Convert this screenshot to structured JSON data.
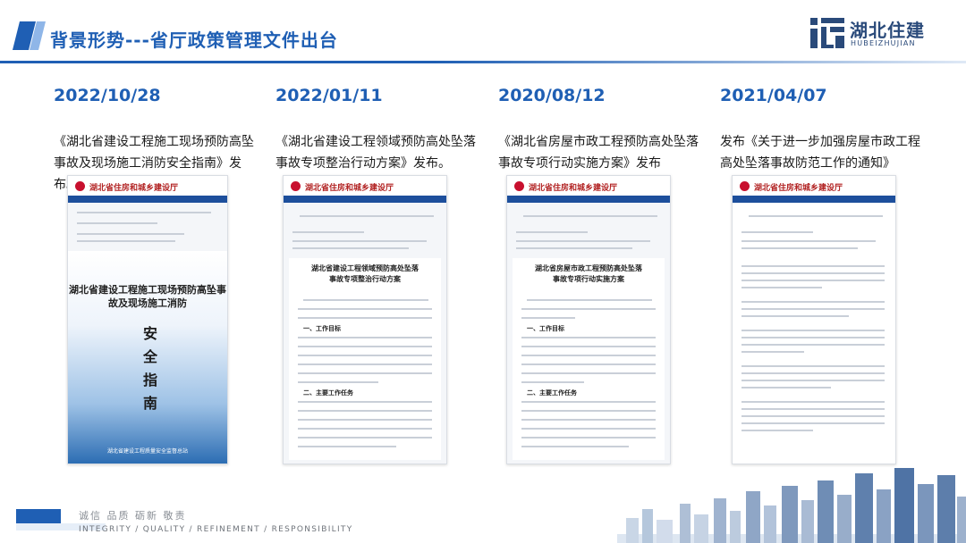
{
  "header": {
    "title": "背景形势---省厅政策管理文件出台",
    "logo_cn": "湖北住建",
    "logo_en": "HUBEIZHUJIAN"
  },
  "colors": {
    "accent": "#1f5fb4",
    "text": "#1a1a1a",
    "site_red": "#b22222"
  },
  "columns": [
    {
      "date": "2022/10/28",
      "description": "《湖北省建设工程施工现场预防高坠事故及现场施工消防安全指南》发布。",
      "doc": {
        "site": "湖北省住房和城乡建设厅",
        "cover_title": "湖北省建设工程施工现场预防高坠事故及现场施工消防",
        "cover_big": "安全指南",
        "cover_foot": "湖北省建设工程质量安全监督总站"
      }
    },
    {
      "date": "2022/01/11",
      "description": "《湖北省建设工程领域预防高处坠落事故专项整治行动方案》发布。",
      "doc": {
        "site": "湖北省住房和城乡建设厅",
        "paper_title": "湖北省建设工程领域预防高处坠落事故专项整治行动方案",
        "section1": "一、工作目标",
        "section2": "二、主要工作任务"
      }
    },
    {
      "date": "2020/08/12",
      "description": "《湖北省房屋市政工程预防高处坠落事故专项行动实施方案》发布",
      "doc": {
        "site": "湖北省住房和城乡建设厅",
        "paper_title": "湖北省房屋市政工程预防高处坠落事故专项行动实施方案",
        "section1": "一、工作目标",
        "section2": "二、主要工作任务"
      }
    },
    {
      "date": "2021/04/07",
      "description": "发布《关于进一步加强房屋市政工程高处坠落事故防范工作的通知》",
      "doc": {
        "site": "湖北省住房和城乡建设厅"
      }
    }
  ],
  "footer": {
    "slogan_cn": "诚信 品质 砺新 敬责",
    "slogan_en": "INTEGRITY / QUALITY / REFINEMENT / RESPONSIBILITY"
  }
}
